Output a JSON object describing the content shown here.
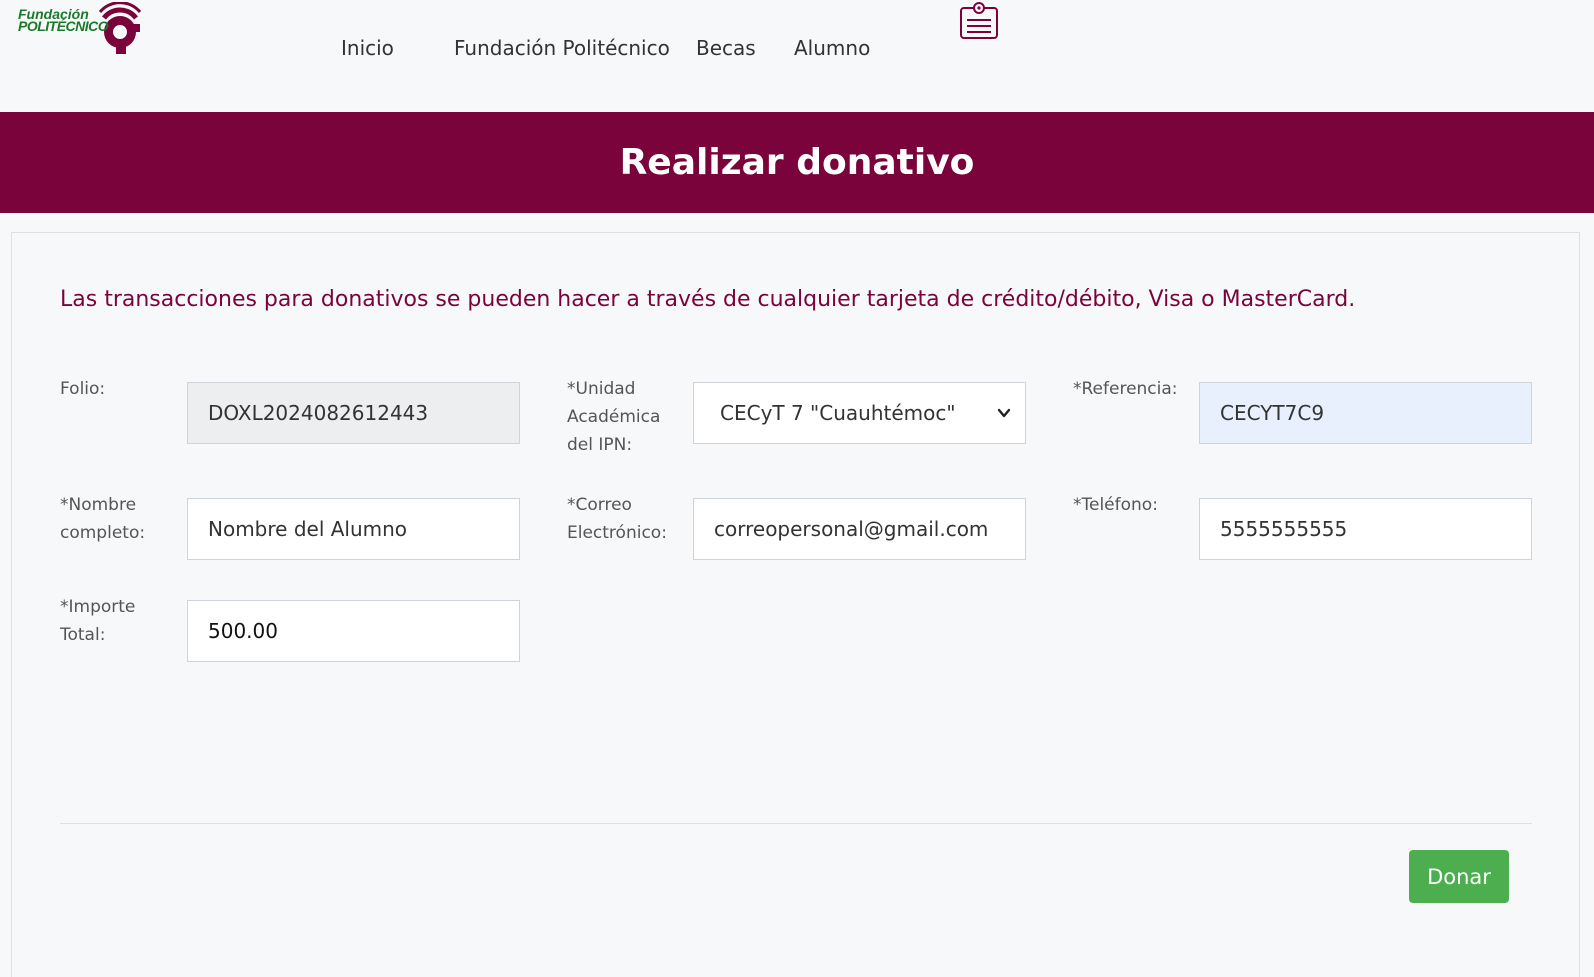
{
  "brand": {
    "logo_line1": "Fundación",
    "logo_line2": "POLITÉCNICO"
  },
  "nav": {
    "items": [
      "Inicio",
      "Fundación Politécnico",
      "Becas",
      "Alumno"
    ],
    "icon": "id-badge-icon"
  },
  "banner": {
    "title": "Realizar donativo"
  },
  "notice": "Las transacciones para donativos se pueden hacer a través de cualquier tarjeta de crédito/débito, Visa o MasterCard.",
  "form": {
    "folio_label": "Folio:",
    "folio_value": "DOXL2024082612443",
    "unidad_label": "*Unidad Académica del IPN:",
    "unidad_value": "CECyT 7 \"Cuauhtémoc\"",
    "referencia_label": "*Referencia:",
    "referencia_value": "CECYT7C9",
    "nombre_label": "*Nombre completo:",
    "nombre_value": "Nombre del Alumno",
    "correo_label": "*Correo Electrónico:",
    "correo_value": "correopersonal@gmail.com",
    "telefono_label": "*Teléfono:",
    "telefono_value": "5555555555",
    "importe_label": "*Importe Total:",
    "importe_value": "500.00"
  },
  "actions": {
    "donate_label": "Donar"
  },
  "colors": {
    "brand_primary": "#7a033b",
    "logo_green": "#1a7a2a",
    "button_green": "#4cae4f",
    "autofill_bg": "#e8f0fe"
  }
}
